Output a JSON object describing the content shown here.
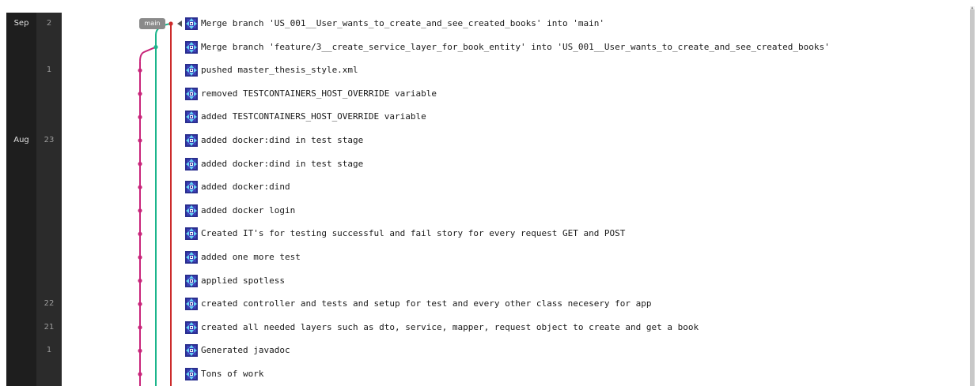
{
  "colors": {
    "branch_main": "#cc2b2b",
    "branch_feature": "#1bb58b",
    "branch_story": "#c8257a",
    "tag_bg": "#8a8a8a"
  },
  "branch_tag": {
    "label": "main"
  },
  "months": [
    {
      "label": "Sep",
      "row": 0
    },
    {
      "label": "Aug",
      "row": 5
    }
  ],
  "days": [
    {
      "label": "2",
      "row": 0
    },
    {
      "label": "1",
      "row": 2
    },
    {
      "label": "23",
      "row": 5
    },
    {
      "label": "22",
      "row": 12
    },
    {
      "label": "21",
      "row": 13
    },
    {
      "label": "1",
      "row": 14
    }
  ],
  "commits": [
    {
      "message": "Merge branch 'US_001__User_wants_to_create_and_see_created_books' into 'main'",
      "lane": "main",
      "avatar": "identicon-icon"
    },
    {
      "message": "Merge branch 'feature/3__create_service_layer_for_book_entity' into 'US_001__User_wants_to_create_and_see_created_books'",
      "lane": "feature",
      "avatar": "identicon-icon"
    },
    {
      "message": "pushed master_thesis_style.xml",
      "lane": "story",
      "avatar": "identicon-icon"
    },
    {
      "message": "removed TESTCONTAINERS_HOST_OVERRIDE variable",
      "lane": "story",
      "avatar": "identicon-icon"
    },
    {
      "message": "added TESTCONTAINERS_HOST_OVERRIDE variable",
      "lane": "story",
      "avatar": "identicon-icon"
    },
    {
      "message": "added docker:dind in test stage",
      "lane": "story",
      "avatar": "identicon-icon"
    },
    {
      "message": "added docker:dind in test stage",
      "lane": "story",
      "avatar": "identicon-icon"
    },
    {
      "message": "added docker:dind",
      "lane": "story",
      "avatar": "identicon-icon"
    },
    {
      "message": "added docker login",
      "lane": "story",
      "avatar": "identicon-icon"
    },
    {
      "message": "Created IT's for testing successful and fail story for every request GET and POST",
      "lane": "story",
      "avatar": "identicon-icon"
    },
    {
      "message": "added one more test",
      "lane": "story",
      "avatar": "identicon-icon"
    },
    {
      "message": "applied spotless",
      "lane": "story",
      "avatar": "identicon-icon"
    },
    {
      "message": "created controller and tests and setup for test and every other class necesery for app",
      "lane": "story",
      "avatar": "identicon-icon"
    },
    {
      "message": "created all needed layers such as dto, service, mapper, request object to create and get a book",
      "lane": "story",
      "avatar": "identicon-icon"
    },
    {
      "message": "Generated javadoc",
      "lane": "story",
      "avatar": "identicon-icon"
    },
    {
      "message": "Tons of work",
      "lane": "story",
      "avatar": "identicon-icon"
    }
  ]
}
